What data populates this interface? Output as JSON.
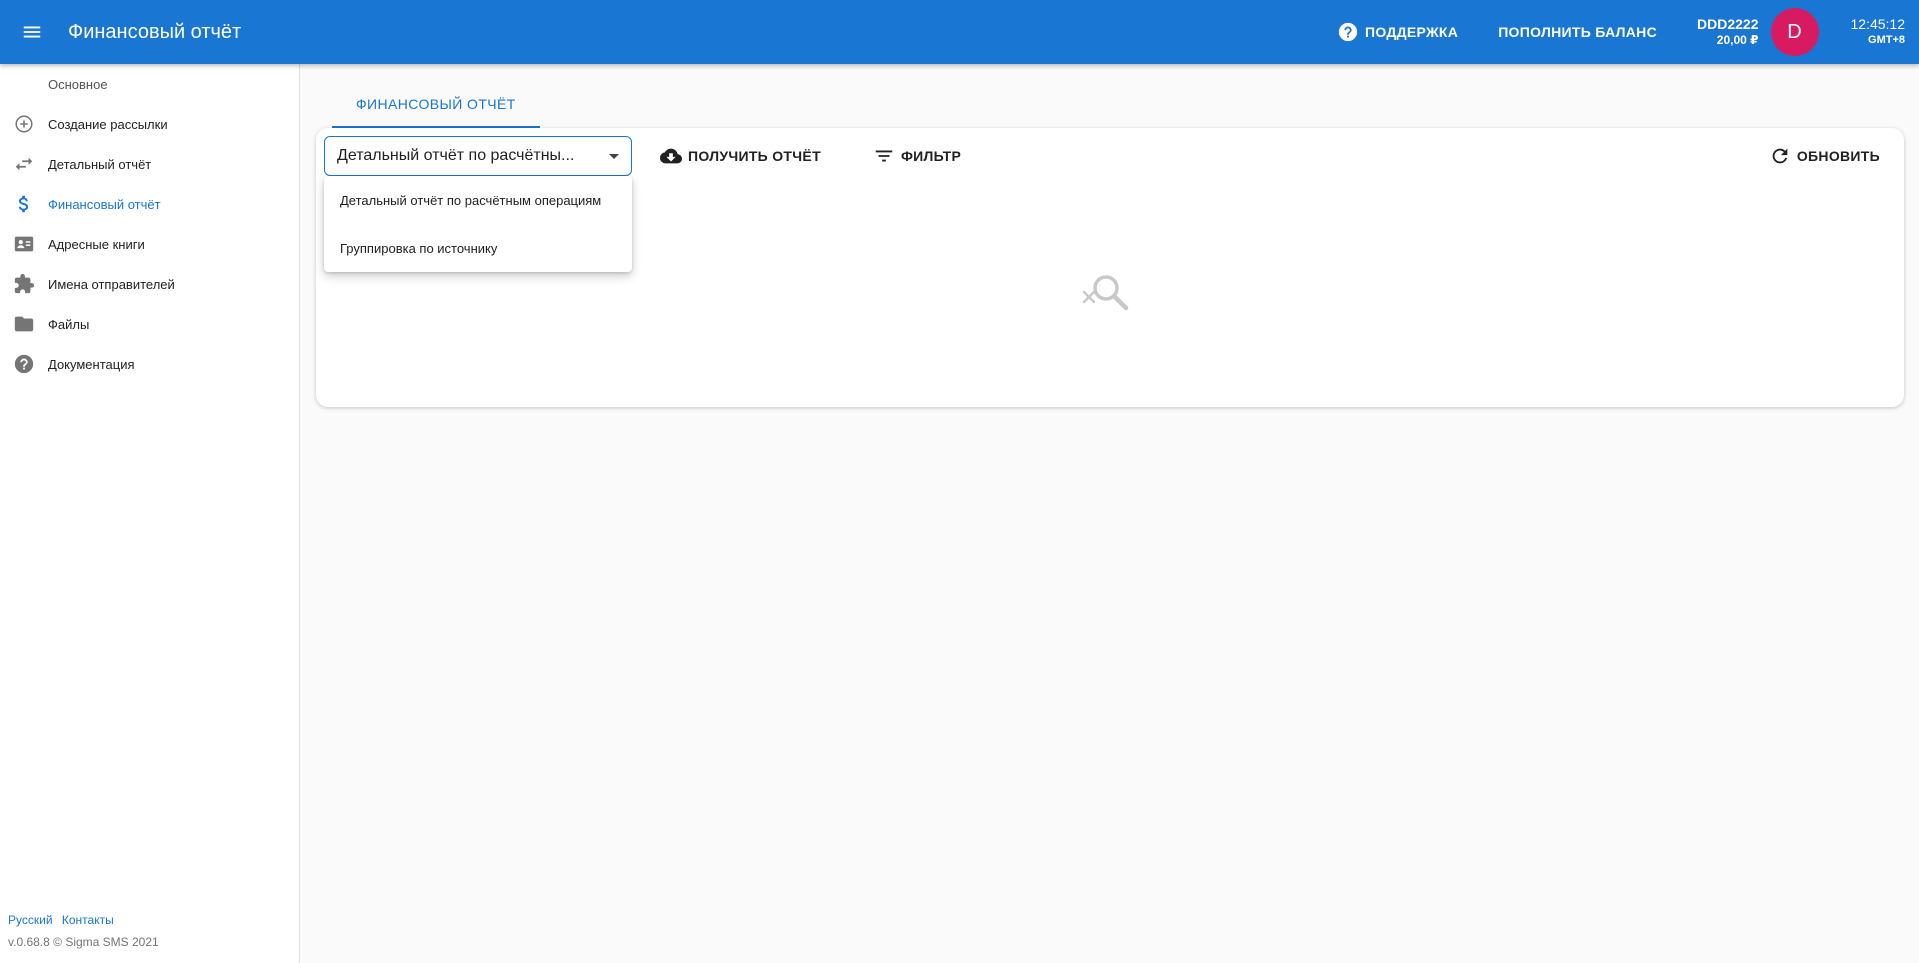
{
  "header": {
    "title": "Финансовый отчёт",
    "support_label": "ПОДДЕРЖКА",
    "top_up_label": "ПОПОЛНИТЬ БАЛАНС",
    "account_name": "DDD2222",
    "account_balance": "20,00 ₽",
    "avatar_letter": "D",
    "time": "12:45:12",
    "timezone": "GMT+8"
  },
  "sidebar": {
    "section": "Основное",
    "items": [
      {
        "label": "Создание рассылки",
        "icon": "add-circle-icon"
      },
      {
        "label": "Детальный отчёт",
        "icon": "swap-arrows-icon"
      },
      {
        "label": "Финансовый отчёт",
        "icon": "dollar-icon",
        "active": true
      },
      {
        "label": "Адресные книги",
        "icon": "contact-card-icon"
      },
      {
        "label": "Имена отправителей",
        "icon": "puzzle-icon"
      },
      {
        "label": "Файлы",
        "icon": "folder-icon"
      },
      {
        "label": "Документация",
        "icon": "help-icon"
      }
    ],
    "footer": {
      "language": "Русский",
      "contacts": "Контакты",
      "version": "v.0.68.8 © Sigma SMS 2021"
    }
  },
  "tabs": [
    {
      "label": "ФИНАНСОВЫЙ ОТЧЁТ",
      "active": true
    }
  ],
  "toolbar": {
    "report_type_value": "Детальный отчёт по расчётны...",
    "get_report_label": "ПОЛУЧИТЬ ОТЧЁТ",
    "filter_label": "ФИЛЬТР",
    "refresh_label": "ОБНОВИТЬ"
  },
  "dropdown": {
    "options": [
      "Детальный отчёт по расчётным операциям",
      "Группировка по источнику"
    ]
  },
  "colors": {
    "primary": "#1976d2",
    "avatar": "#d81b60",
    "background": "#fafafa"
  }
}
